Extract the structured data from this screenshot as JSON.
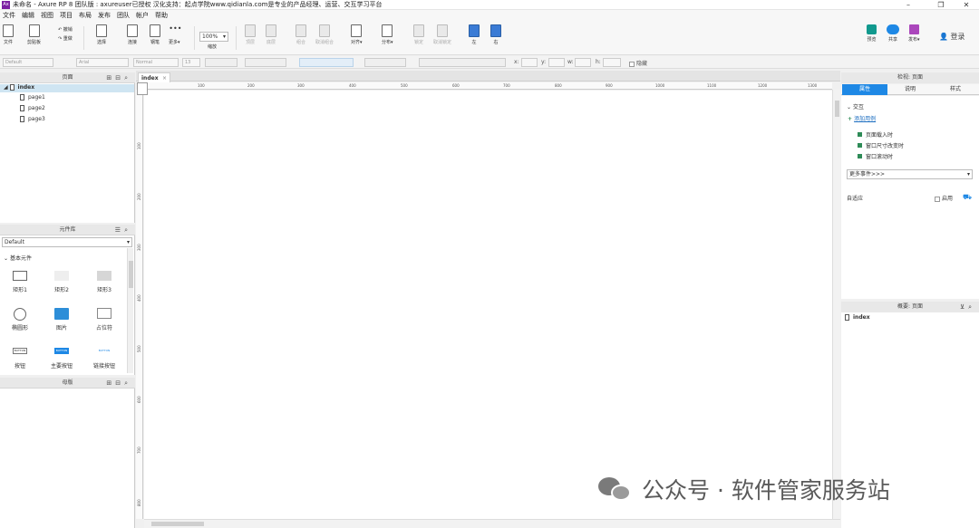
{
  "window": {
    "app_icon": "Ax",
    "title": "未命名 - Axure RP 8 团队版 : axureuser已授权 汉化支持：起点学院www.qidianla.com是专业的产品经理、运营、交互学习平台",
    "minimize": "–",
    "maximize": "❐",
    "close": "✕"
  },
  "menu": [
    "文件",
    "编辑",
    "视图",
    "项目",
    "布局",
    "发布",
    "团队",
    "帐户",
    "帮助"
  ],
  "toolbar": {
    "file": "文件",
    "clipboard": "剪贴板",
    "undo": "撤销",
    "redo": "重做",
    "select": "选择",
    "connect": "连接",
    "pen": "钢笔",
    "more": "更多▾",
    "zoom_value": "100%",
    "zoom_label": "缩放",
    "top": "顶层",
    "bottom": "底层",
    "group": "组合",
    "ungroup": "取消组合",
    "align": "对齐▾",
    "distribute": "分布▾",
    "lock": "锁定",
    "unlock": "取消锁定",
    "left": "左",
    "right": "右",
    "preview": "预览",
    "share": "共享",
    "publish": "发布▾",
    "login": "登录"
  },
  "formatbar": {
    "style": "Default",
    "font": "Arial",
    "weight": "Normal",
    "size": "13",
    "x_label": "x:",
    "y_label": "y:",
    "w_label": "w:",
    "h_label": "h:",
    "hidden_label": "隐藏"
  },
  "pages_panel": {
    "title": "页面",
    "pages": [
      "index",
      "page1",
      "page2",
      "page3"
    ]
  },
  "library_panel": {
    "title": "元件库",
    "selected_library": "Default",
    "section": "基本元件",
    "widgets": [
      "矩形1",
      "矩形2",
      "矩形3",
      "椭圆形",
      "图片",
      "占位符",
      "按钮",
      "主要按钮",
      "链接按钮"
    ],
    "button_text": "BUTTON"
  },
  "masters_panel": {
    "title": "母版"
  },
  "canvas": {
    "tab": "index",
    "ruler_h": [
      "100",
      "200",
      "300",
      "400",
      "500",
      "600",
      "700",
      "800",
      "900",
      "1000",
      "1100",
      "1200",
      "1300"
    ],
    "ruler_v": [
      "100",
      "200",
      "300",
      "400",
      "500",
      "600",
      "700",
      "800"
    ]
  },
  "inspector": {
    "title": "检视: 页面",
    "tabs": [
      "属性",
      "说明",
      "样式"
    ],
    "interaction_label": "交互",
    "add_case": "添加用例",
    "events": [
      "页面载入时",
      "窗口尺寸改变时",
      "窗口滚动时"
    ],
    "more_events": "更多事件>>>",
    "adaptive": "自适应",
    "enable": "启用"
  },
  "outline": {
    "title": "概要: 页面",
    "items": [
      "index"
    ]
  },
  "watermark": {
    "text": "公众号 · 软件管家服务站"
  }
}
